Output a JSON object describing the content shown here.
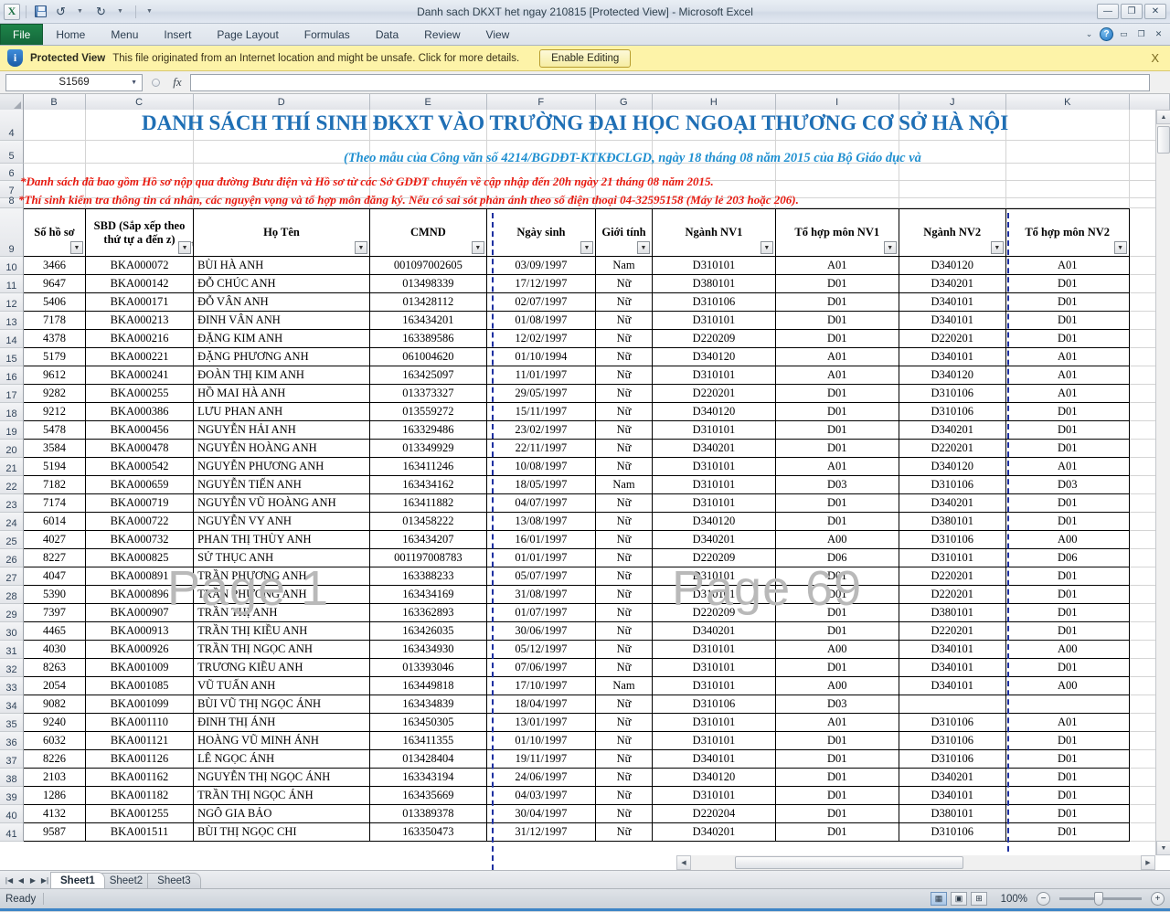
{
  "window": {
    "title": "Danh sach DKXT het ngay 210815  [Protected View]  -  Microsoft Excel",
    "quick_access": [
      "save-icon",
      "undo-icon",
      "redo-icon",
      "customize-icon"
    ],
    "buttons": {
      "minimize": "—",
      "restore": "❐",
      "close": "✕"
    }
  },
  "ribbon": {
    "tabs": [
      "File",
      "Home",
      "Menu",
      "Insert",
      "Page Layout",
      "Formulas",
      "Data",
      "Review",
      "View"
    ],
    "right_icons": [
      "minimize-ribbon-icon",
      "help-icon",
      "minimize-icon",
      "restore-icon",
      "close-icon"
    ],
    "help_glyph": "?"
  },
  "protected_view": {
    "label": "Protected View",
    "message": "This file originated from an Internet location and might be unsafe. Click for more details.",
    "enable_button": "Enable Editing",
    "close": "X",
    "shield_glyph": "i",
    "bg_color": "#fdf3a8"
  },
  "formula_bar": {
    "name_box": "S1569",
    "caret": "▼",
    "fx": "fx",
    "value": ""
  },
  "grid": {
    "column_letters": [
      "B",
      "C",
      "D",
      "E",
      "F",
      "G",
      "H",
      "I",
      "J",
      "K"
    ],
    "row_numbers": [
      "4",
      "5",
      "6",
      "7",
      "8",
      "9",
      "10",
      "11",
      "12",
      "13",
      "14",
      "15",
      "16",
      "17",
      "18",
      "19",
      "20",
      "21",
      "22",
      "23",
      "24",
      "25",
      "26",
      "27",
      "28",
      "29",
      "30",
      "31",
      "32",
      "33",
      "34",
      "35",
      "36",
      "37",
      "38",
      "39",
      "40",
      "41"
    ],
    "title_main": "DANH SÁCH THÍ SINH ĐKXT VÀO TRƯỜNG ĐẠI HỌC NGOẠI THƯƠNG CƠ SỞ HÀ NỘI",
    "title_sub": "(Theo mẫu của Công văn số 4214/BGDĐT-KTKĐCLGD, ngày 18 tháng 08 năm 2015 của Bộ Giáo dục và",
    "note1": "*Danh sách đã bao gồm Hồ sơ nộp qua đường Bưu điện và Hồ sơ từ các Sở GDĐT chuyển về cập nhập đến 20h ngày 21 tháng 08 năm 2015.",
    "note2": "*Thí sinh kiểm tra thông tin cá nhân, các nguyện vọng và tổ hợp môn đăng ký. Nếu có sai sót phản ánh theo số điện thoại 04-32595158 (Máy lẻ 203 hoặc 206).",
    "watermarks": [
      "Page 1",
      "Page 69"
    ],
    "headers": [
      "Số hồ sơ",
      "SBD (Sắp xếp theo thứ tự a đến z)",
      "Họ Tên",
      "CMND",
      "Ngày sinh",
      "Giới tính",
      "Ngành NV1",
      "Tổ hợp môn NV1",
      "Ngành NV2",
      "Tổ hợp môn NV2"
    ],
    "rows": [
      [
        "3466",
        "BKA000072",
        "BÙI HÀ ANH",
        "001097002605",
        "03/09/1997",
        "Nam",
        "D310101",
        "A01",
        "D340120",
        "A01"
      ],
      [
        "9647",
        "BKA000142",
        "ĐỖ CHÚC ANH",
        "013498339",
        "17/12/1997",
        "Nữ",
        "D380101",
        "D01",
        "D340201",
        "D01"
      ],
      [
        "5406",
        "BKA000171",
        "ĐỖ VÂN ANH",
        "013428112",
        "02/07/1997",
        "Nữ",
        "D310106",
        "D01",
        "D340101",
        "D01"
      ],
      [
        "7178",
        "BKA000213",
        "ĐINH VÂN ANH",
        "163434201",
        "01/08/1997",
        "Nữ",
        "D310101",
        "D01",
        "D340101",
        "D01"
      ],
      [
        "4378",
        "BKA000216",
        "ĐẶNG KIM ANH",
        "163389586",
        "12/02/1997",
        "Nữ",
        "D220209",
        "D01",
        "D220201",
        "D01"
      ],
      [
        "5179",
        "BKA000221",
        "ĐẶNG PHƯƠNG ANH",
        "061004620",
        "01/10/1994",
        "Nữ",
        "D340120",
        "A01",
        "D340101",
        "A01"
      ],
      [
        "9612",
        "BKA000241",
        "ĐOÀN THỊ KIM ANH",
        "163425097",
        "11/01/1997",
        "Nữ",
        "D310101",
        "A01",
        "D340120",
        "A01"
      ],
      [
        "9282",
        "BKA000255",
        "HỒ MAI HÀ ANH",
        "013373327",
        "29/05/1997",
        "Nữ",
        "D220201",
        "D01",
        "D310106",
        "A01"
      ],
      [
        "9212",
        "BKA000386",
        "LƯU PHAN ANH",
        "013559272",
        "15/11/1997",
        "Nữ",
        "D340120",
        "D01",
        "D310106",
        "D01"
      ],
      [
        "5478",
        "BKA000456",
        "NGUYỄN HẢI ANH",
        "163329486",
        "23/02/1997",
        "Nữ",
        "D310101",
        "D01",
        "D340201",
        "D01"
      ],
      [
        "3584",
        "BKA000478",
        "NGUYỄN HOÀNG ANH",
        "013349929",
        "22/11/1997",
        "Nữ",
        "D340201",
        "D01",
        "D220201",
        "D01"
      ],
      [
        "5194",
        "BKA000542",
        "NGUYỄN PHƯƠNG ANH",
        "163411246",
        "10/08/1997",
        "Nữ",
        "D310101",
        "A01",
        "D340120",
        "A01"
      ],
      [
        "7182",
        "BKA000659",
        "NGUYỄN TIẾN ANH",
        "163434162",
        "18/05/1997",
        "Nam",
        "D310101",
        "D03",
        "D310106",
        "D03"
      ],
      [
        "7174",
        "BKA000719",
        "NGUYỄN VŨ HOÀNG ANH",
        "163411882",
        "04/07/1997",
        "Nữ",
        "D310101",
        "D01",
        "D340201",
        "D01"
      ],
      [
        "6014",
        "BKA000722",
        "NGUYỄN VY ANH",
        "013458222",
        "13/08/1997",
        "Nữ",
        "D340120",
        "D01",
        "D380101",
        "D01"
      ],
      [
        "4027",
        "BKA000732",
        "PHAN THỊ THÙY ANH",
        "163434207",
        "16/01/1997",
        "Nữ",
        "D340201",
        "A00",
        "D310106",
        "A00"
      ],
      [
        "8227",
        "BKA000825",
        "SỬ THỤC ANH",
        "001197008783",
        "01/01/1997",
        "Nữ",
        "D220209",
        "D06",
        "D310101",
        "D06"
      ],
      [
        "4047",
        "BKA000891",
        "TRẦN PHƯƠNG ANH",
        "163388233",
        "05/07/1997",
        "Nữ",
        "D310101",
        "D01",
        "D220201",
        "D01"
      ],
      [
        "5390",
        "BKA000896",
        "TRẦN PHƯƠNG ANH",
        "163434169",
        "31/08/1997",
        "Nữ",
        "D310101",
        "D01",
        "D220201",
        "D01"
      ],
      [
        "7397",
        "BKA000907",
        "TRẦN THỊ ANH",
        "163362893",
        "01/07/1997",
        "Nữ",
        "D220209",
        "D01",
        "D380101",
        "D01"
      ],
      [
        "4465",
        "BKA000913",
        "TRẦN THỊ KIỀU ANH",
        "163426035",
        "30/06/1997",
        "Nữ",
        "D340201",
        "D01",
        "D220201",
        "D01"
      ],
      [
        "4030",
        "BKA000926",
        "TRẦN THỊ NGỌC ANH",
        "163434930",
        "05/12/1997",
        "Nữ",
        "D310101",
        "A00",
        "D340101",
        "A00"
      ],
      [
        "8263",
        "BKA001009",
        "TRƯƠNG KIỀU ANH",
        "013393046",
        "07/06/1997",
        "Nữ",
        "D310101",
        "D01",
        "D340101",
        "D01"
      ],
      [
        "2054",
        "BKA001085",
        "VŨ TUẤN ANH",
        "163449818",
        "17/10/1997",
        "Nam",
        "D310101",
        "A00",
        "D340101",
        "A00"
      ],
      [
        "9082",
        "BKA001099",
        "BÙI VŨ THỊ NGỌC ÁNH",
        "163434839",
        "18/04/1997",
        "Nữ",
        "D310106",
        "D03",
        "",
        ""
      ],
      [
        "9240",
        "BKA001110",
        "ĐINH THỊ ÁNH",
        "163450305",
        "13/01/1997",
        "Nữ",
        "D310101",
        "A01",
        "D310106",
        "A01"
      ],
      [
        "6032",
        "BKA001121",
        "HOÀNG VŨ MINH ÁNH",
        "163411355",
        "01/10/1997",
        "Nữ",
        "D310101",
        "D01",
        "D310106",
        "D01"
      ],
      [
        "8226",
        "BKA001126",
        "LÊ NGỌC ÁNH",
        "013428404",
        "19/11/1997",
        "Nữ",
        "D340101",
        "D01",
        "D310106",
        "D01"
      ],
      [
        "2103",
        "BKA001162",
        "NGUYỄN THỊ NGỌC ÁNH",
        "163343194",
        "24/06/1997",
        "Nữ",
        "D340120",
        "D01",
        "D340201",
        "D01"
      ],
      [
        "1286",
        "BKA001182",
        "TRẦN THỊ NGỌC ÁNH",
        "163435669",
        "04/03/1997",
        "Nữ",
        "D310101",
        "D01",
        "D340101",
        "D01"
      ],
      [
        "4132",
        "BKA001255",
        "NGÔ GIA BẢO",
        "013389378",
        "30/04/1997",
        "Nữ",
        "D220204",
        "D01",
        "D380101",
        "D01"
      ],
      [
        "9587",
        "BKA001511",
        "BÙI THỊ NGỌC CHI",
        "163350473",
        "31/12/1997",
        "Nữ",
        "D340201",
        "D01",
        "D310106",
        "D01"
      ]
    ]
  },
  "sheet_tabs": {
    "nav": [
      "first-icon",
      "prev-icon",
      "next-icon",
      "last-icon"
    ],
    "tabs": [
      "Sheet1",
      "Sheet2",
      "Sheet3"
    ],
    "active": "Sheet1"
  },
  "status_bar": {
    "text": "Ready",
    "view_buttons": [
      "normal-view-icon",
      "page-layout-icon",
      "page-break-preview-icon"
    ],
    "zoom": "100%",
    "zoom_out": "−",
    "zoom_in": "+"
  }
}
